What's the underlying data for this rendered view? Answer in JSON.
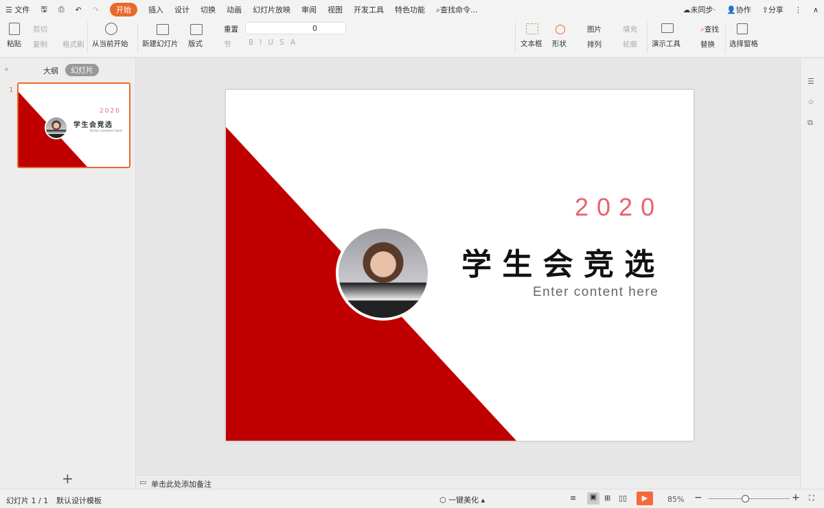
{
  "menubar": {
    "file": "文件",
    "tabs": [
      "开始",
      "插入",
      "设计",
      "切换",
      "动画",
      "幻灯片放映",
      "审阅",
      "视图",
      "开发工具",
      "特色功能"
    ],
    "search": "查找命令...",
    "sync": "未同步",
    "collab": "协作",
    "share": "分享"
  },
  "toolbar": {
    "paste": "粘贴",
    "cut": "剪切",
    "copy": "复制",
    "format_painter": "格式刷",
    "from_current": "从当前开始",
    "new_slide": "新建幻灯片",
    "layout": "版式",
    "reset": "重置",
    "section": "节",
    "font_size": "0",
    "text_box": "文本框",
    "shape": "形状",
    "picture": "图片",
    "fill": "填充",
    "arrange": "排列",
    "outline": "轮廓",
    "present_tools": "演示工具",
    "find": "查找",
    "replace": "替换",
    "selection_pane": "选择窗格"
  },
  "leftpane": {
    "outline_tab": "大纲",
    "slides_tab": "幻灯片",
    "slide_number": "1"
  },
  "slide": {
    "year": "2020",
    "title": "学 生 会 竞 选",
    "subtitle": "Enter content here",
    "colors": {
      "red": "#c00000",
      "year": "#e8626e"
    }
  },
  "notes": {
    "placeholder": "单击此处添加备注"
  },
  "statusbar": {
    "slide_count": "幻灯片 1 / 1",
    "template": "默认设计模板",
    "beautify": "一键美化",
    "zoom": "85%",
    "zoom_level": 0.45
  },
  "accent": "#e9692c"
}
